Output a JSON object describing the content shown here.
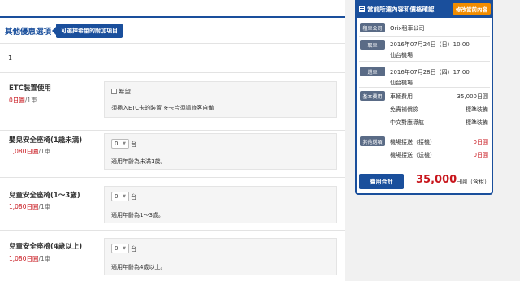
{
  "section": {
    "title": "其他優惠選項",
    "tag": "可選擇希望的附加項目",
    "count": "1"
  },
  "options": [
    {
      "name": "ETC裝置使用",
      "price": "0日圓",
      "price_unit": "/1車",
      "control": "checkbox",
      "control_label": "希望",
      "note": "須插入ETC卡的裝置 ※卡片須請旅客自備"
    },
    {
      "name": "嬰兒安全座椅(1歳未満)",
      "price": "1,080日圓",
      "price_unit": "/1車",
      "control": "select",
      "select_value": "0",
      "select_unit": "台",
      "note": "適用年齡為未滿1歲。"
    },
    {
      "name": "兒童安全座椅(1〜3歲)",
      "price": "1,080日圓",
      "price_unit": "/1車",
      "control": "select",
      "select_value": "0",
      "select_unit": "台",
      "note": "適用年齡為1〜3歲。"
    },
    {
      "name": "兒童安全座椅(4歲以上)",
      "price": "1,080日圓",
      "price_unit": "/1車",
      "control": "select",
      "select_value": "0",
      "select_unit": "台",
      "note": "適用年齡為4歲以上。"
    }
  ],
  "summary": {
    "title": "當前所選內容和價格確認",
    "edit_button": "修改當前內容",
    "rental_label": "租車公司",
    "rental_value": "Orix租車公司",
    "pickup_label": "取車",
    "pickup_date": "2016年07月24日（日）10:00",
    "pickup_place": "仙台機場",
    "return_label": "還車",
    "return_date": "2016年07月28日（四）17:00",
    "return_place": "仙台機場",
    "basic_label": "基本費用",
    "basic_items": [
      {
        "name": "車輛費用",
        "value": "35,000日圓"
      },
      {
        "name": "免責補償險",
        "value": "標準裝備"
      },
      {
        "name": "中文對應導航",
        "value": "標準裝備"
      }
    ],
    "other_label": "其他選項",
    "other_items": [
      {
        "name": "機場接送（接機）",
        "value": "0日圓"
      },
      {
        "name": "機場接送（送機）",
        "value": "0日圓"
      }
    ],
    "total_label": "費用合計",
    "total_amount": "35,000",
    "total_unit": "日圓（含稅）"
  },
  "colors": {
    "brand_blue": "#1a4f9c",
    "price_red": "#c8161d",
    "edit_orange": "#f08c00"
  }
}
